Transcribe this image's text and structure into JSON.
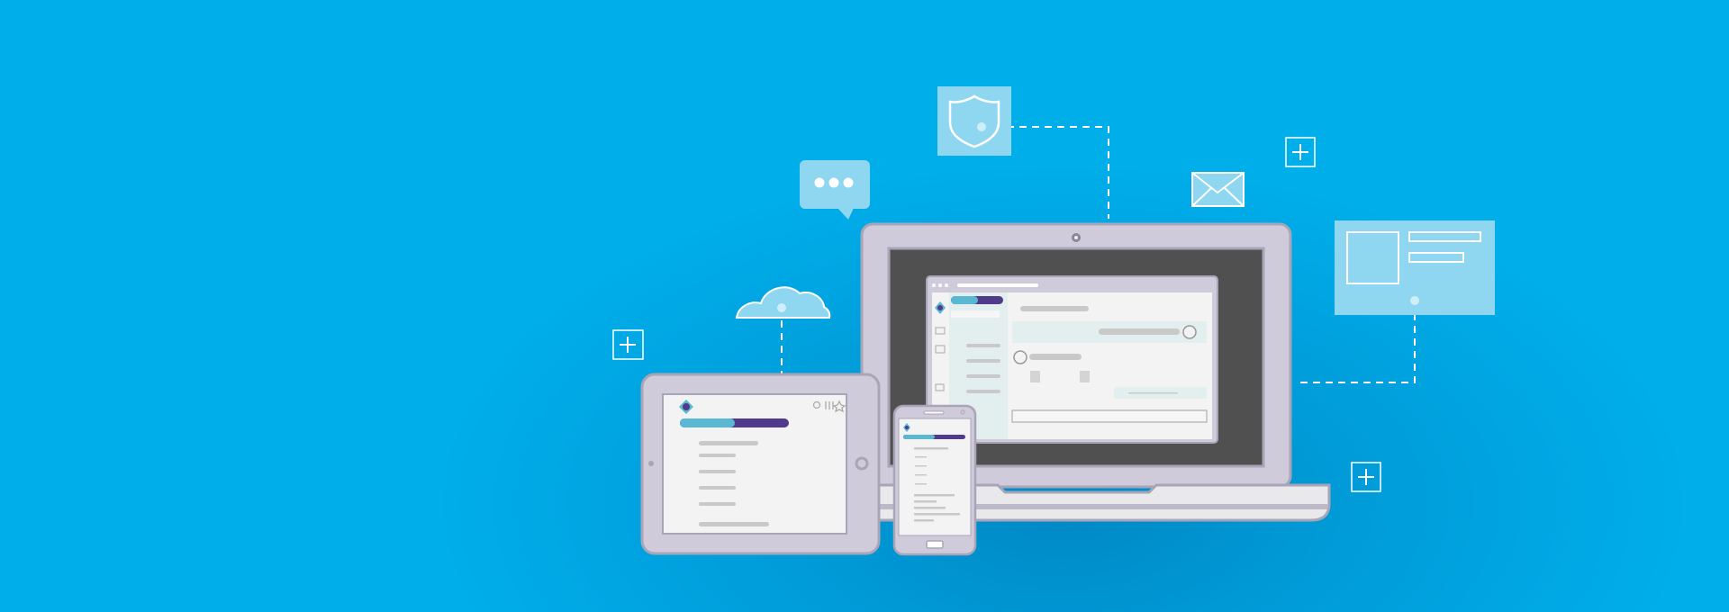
{
  "colors": {
    "background": "#00aeea",
    "device_frame": "#cfcbda",
    "device_edge": "#a9a5b8",
    "laptop_screen": "#505050",
    "app_bg": "#f3f3f3",
    "sidebar_bg": "#e3eeef",
    "accent_teal": "#5bb8d2",
    "accent_purple": "#4f3a8c",
    "icon_panel": "#8fd6f0"
  },
  "icons": [
    "shield-icon",
    "chat-bubble-icon",
    "envelope-icon",
    "plus-icon",
    "cloud-icon",
    "card-icon",
    "hash-icon",
    "chat-icon",
    "search-icon",
    "filter-icon",
    "star-icon",
    "user-icon",
    "document-icon",
    "bell-icon",
    "add-icon",
    "app-logo"
  ]
}
